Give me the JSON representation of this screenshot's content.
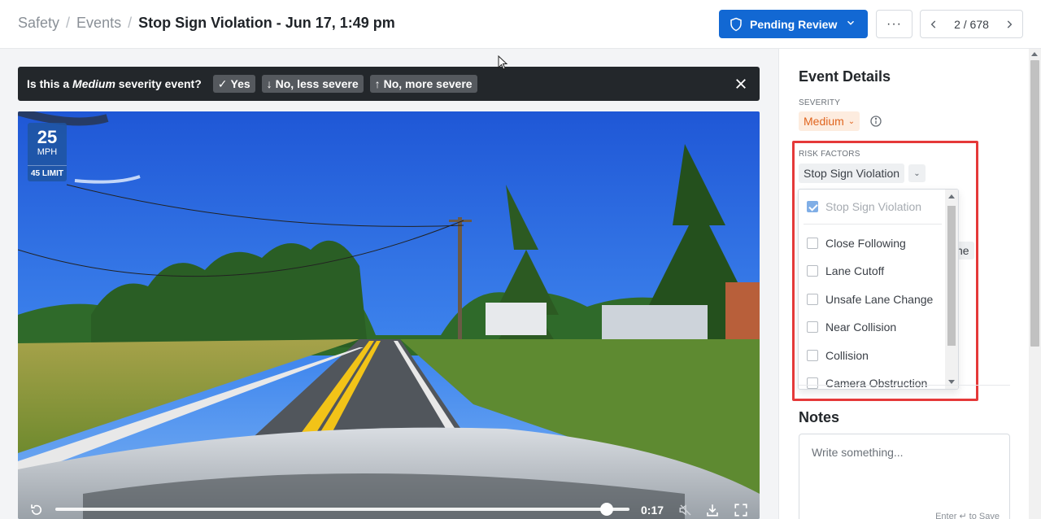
{
  "breadcrumb": {
    "items": [
      "Safety",
      "Events"
    ],
    "separator": "/",
    "title": "Stop Sign Violation - Jun 17, 1:49 pm"
  },
  "header": {
    "status_button": "Pending Review",
    "more_label": "···",
    "pager": {
      "current": "2",
      "total": "678",
      "text": "2 / 678"
    }
  },
  "prompt": {
    "prefix": "Is this a ",
    "severity": "Medium",
    "suffix": " severity event?",
    "options": [
      {
        "glyph": "✓",
        "label": "Yes"
      },
      {
        "glyph": "↓",
        "label": "No, less severe"
      },
      {
        "glyph": "↑",
        "label": "No, more severe"
      }
    ]
  },
  "video": {
    "speed": "25",
    "speed_unit": "MPH",
    "limit": "45 LIMIT",
    "time": "0:17",
    "progress": 0.96
  },
  "details": {
    "title": "Event Details",
    "severity_label": "SEVERITY",
    "severity_value": "Medium",
    "risk_label": "RISK FACTORS",
    "risk_selected": "Stop Sign Violation",
    "behind_fragment": "ne",
    "dropdown_items": [
      {
        "label": "Stop Sign Violation",
        "checked": true,
        "disabled": true
      },
      {
        "label": "Close Following",
        "checked": false
      },
      {
        "label": "Lane Cutoff",
        "checked": false
      },
      {
        "label": "Unsafe Lane Change",
        "checked": false
      },
      {
        "label": "Near Collision",
        "checked": false
      },
      {
        "label": "Collision",
        "checked": false
      },
      {
        "label": "Camera Obstruction",
        "checked": false
      }
    ]
  },
  "notes": {
    "title": "Notes",
    "placeholder": "Write something...",
    "hint": "Enter ↵ to Save"
  },
  "colors": {
    "primary": "#1268d3",
    "severity_text": "#e0651f",
    "severity_bg": "#fdecdf",
    "highlight": "#e53939"
  }
}
